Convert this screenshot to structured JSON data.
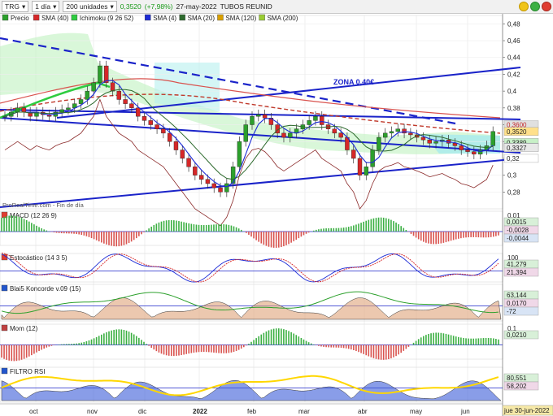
{
  "toolbar": {
    "symbol": "TRG",
    "interval": "1 día",
    "units": "200 unidades",
    "price": "0,3520",
    "change": "(+7,98%)",
    "date": "27-may-2022",
    "name": "TUBOS REUNID"
  },
  "colors": {
    "up": "#2ca02c",
    "down": "#d62728",
    "axis": "#333333"
  },
  "chart_data": [
    {
      "type": "candlestick",
      "title": "",
      "legend": [
        "Precio",
        "SMA (40)",
        "Ichimoku (9 26 52)",
        "SMA (4)",
        "SMA (20)",
        "SMA (120)",
        "SMA (200)"
      ],
      "ylim": [
        0.26,
        0.49
      ],
      "y_ticks": [
        "0,48",
        "0,46",
        "0,44",
        "0,42",
        "0,4",
        "0,38",
        "0,36",
        "0,34",
        "0,32",
        "0,3",
        "0,28"
      ],
      "x_ticks": [
        "oct",
        "nov",
        "dic",
        "2022",
        "feb",
        "mar",
        "abr",
        "may",
        "jun"
      ],
      "price_tags": [
        "0,3600",
        "0,3520",
        "0,3389",
        "0,3333",
        "0,3327",
        "0,32"
      ],
      "annotation": "ZONA 0,40€",
      "watermark": "ProRealTime.com - Fin de día",
      "close_series": [
        0.37,
        0.375,
        0.38,
        0.375,
        0.37,
        0.375,
        0.372,
        0.37,
        0.375,
        0.378,
        0.38,
        0.385,
        0.39,
        0.4,
        0.41,
        0.43,
        0.41,
        0.4,
        0.39,
        0.385,
        0.38,
        0.37,
        0.365,
        0.36,
        0.355,
        0.35,
        0.34,
        0.33,
        0.32,
        0.31,
        0.3,
        0.295,
        0.29,
        0.285,
        0.28,
        0.29,
        0.31,
        0.34,
        0.36,
        0.37,
        0.372,
        0.368,
        0.36,
        0.35,
        0.345,
        0.35,
        0.355,
        0.36,
        0.365,
        0.37,
        0.36,
        0.355,
        0.35,
        0.345,
        0.33,
        0.32,
        0.3,
        0.31,
        0.33,
        0.345,
        0.35,
        0.352,
        0.355,
        0.35,
        0.348,
        0.345,
        0.342,
        0.338,
        0.34,
        0.342,
        0.338,
        0.335,
        0.33,
        0.328,
        0.325,
        0.33,
        0.335,
        0.352
      ]
    },
    {
      "type": "histogram",
      "title": "MACD (12 26 9)",
      "y_ticks": [
        "0,01"
      ],
      "price_tags": [
        "0,0015",
        "-0,0028",
        "-0,0044"
      ]
    },
    {
      "type": "line",
      "title": "Estocástico (14 3 5)",
      "y_ticks": [
        "100"
      ],
      "price_tags": [
        "41,279",
        "21,394"
      ]
    },
    {
      "type": "area",
      "title": "Blai5 Koncorde v.09 (15)",
      "price_tags": [
        "63,144",
        "0,0170",
        "-72"
      ]
    },
    {
      "type": "histogram",
      "title": "Mom (12)",
      "y_ticks": [
        "0,1"
      ],
      "price_tags": [
        "0,0210"
      ]
    },
    {
      "type": "area",
      "title": "FILTRO RSI",
      "price_tags": [
        "80,551",
        "58,202"
      ]
    }
  ],
  "footer_date": "jue 30-jun-2022"
}
